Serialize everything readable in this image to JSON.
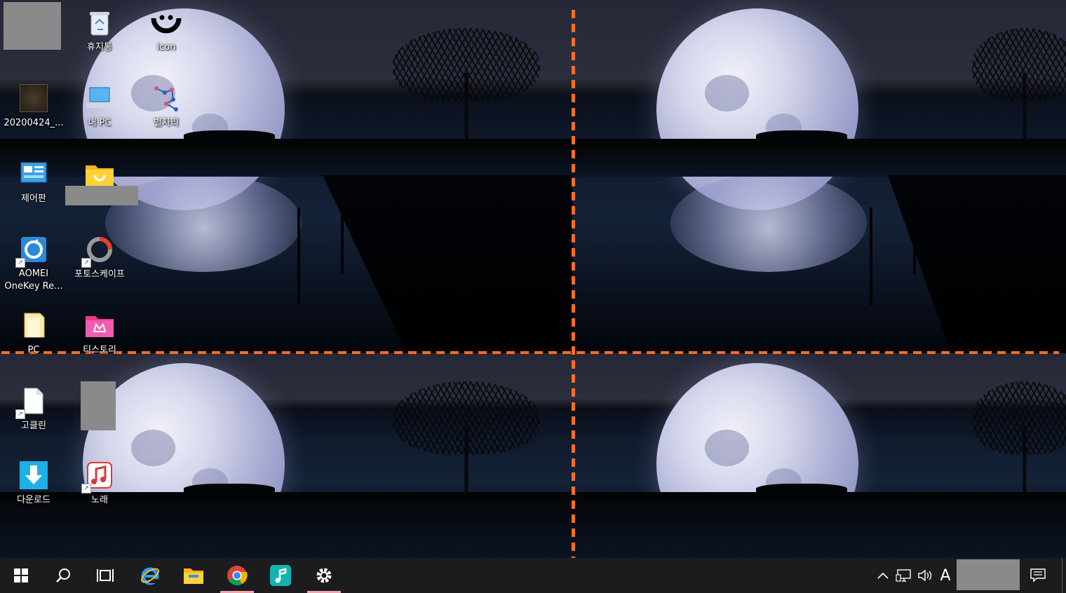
{
  "desktop": {
    "icons": {
      "recycle_bin": "휴지통",
      "icon_app": "icon",
      "file_2020": "20200424_...",
      "my_pc": "내 PC",
      "stars_app": "별자리",
      "control_panel": "제어판",
      "aomei_line1": "AOMEI",
      "aomei_line2": "OneKey Re...",
      "photoscape": "포토스케이프",
      "pc_folder": "PC",
      "tistory": "티스토리",
      "goclean": "고클린",
      "download": "다운로드",
      "song": "노래"
    }
  },
  "taskbar": {
    "ime_label": "A"
  },
  "colors": {
    "divider": "#ff6d22",
    "taskbar_bg": "#1c1c1e",
    "active_underline": "#f2a3b4"
  },
  "icon_names": [
    "windows-start-icon",
    "search-icon",
    "task-view-icon",
    "internet-explorer-icon",
    "file-explorer-icon",
    "chrome-icon",
    "music-app-icon",
    "settings-icon",
    "chevron-up-icon",
    "network-icon",
    "volume-icon",
    "notification-icon"
  ]
}
